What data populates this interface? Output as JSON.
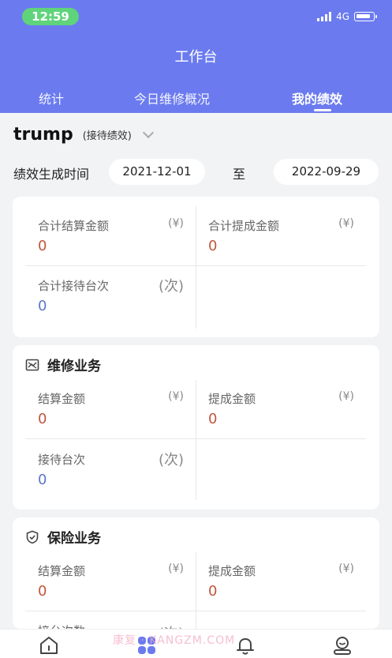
{
  "status_bar": {
    "time": "12:59",
    "network": "4G"
  },
  "header": {
    "title": "工作台"
  },
  "tabs": [
    {
      "label": "统计"
    },
    {
      "label": "今日维修概况"
    },
    {
      "label": "我的绩效"
    }
  ],
  "active_tab": "我的绩效",
  "person": {
    "name": "trump",
    "role": "(接待绩效)"
  },
  "date_range": {
    "label": "绩效生成时间",
    "start": "2021-12-01",
    "separator": "至",
    "end": "2022-09-29"
  },
  "summary": {
    "settlement_label": "合计结算金额",
    "settlement_unit": "(¥)",
    "settlement_value": "0",
    "commission_label": "合计提成金额",
    "commission_unit": "(¥)",
    "commission_value": "0",
    "reception_label": "合计接待台次",
    "reception_unit": "(次)",
    "reception_value": "0"
  },
  "repair": {
    "title": "维修业务",
    "settlement_label": "结算金额",
    "settlement_unit": "(¥)",
    "settlement_value": "0",
    "commission_label": "提成金额",
    "commission_unit": "(¥)",
    "commission_value": "0",
    "reception_label": "接待台次",
    "reception_unit": "(次)",
    "reception_value": "0"
  },
  "insurance": {
    "title": "保险业务",
    "settlement_label": "结算金额",
    "settlement_unit": "(¥)",
    "settlement_value": "0",
    "commission_label": "提成金额",
    "commission_unit": "(¥)",
    "commission_value": "0",
    "count_label": "接台次数",
    "count_unit": "(次)"
  },
  "bottom_nav": [
    {
      "icon": "home-icon"
    },
    {
      "icon": "apps-icon"
    },
    {
      "icon": "bell-icon"
    },
    {
      "icon": "profile-icon"
    }
  ],
  "watermark": "康复 · KANGZM.COM",
  "colors": {
    "header": "#6b7bef",
    "value_red": "#c0563e",
    "value_blue": "#5b78c8",
    "active_nav": "#6b7bef"
  }
}
